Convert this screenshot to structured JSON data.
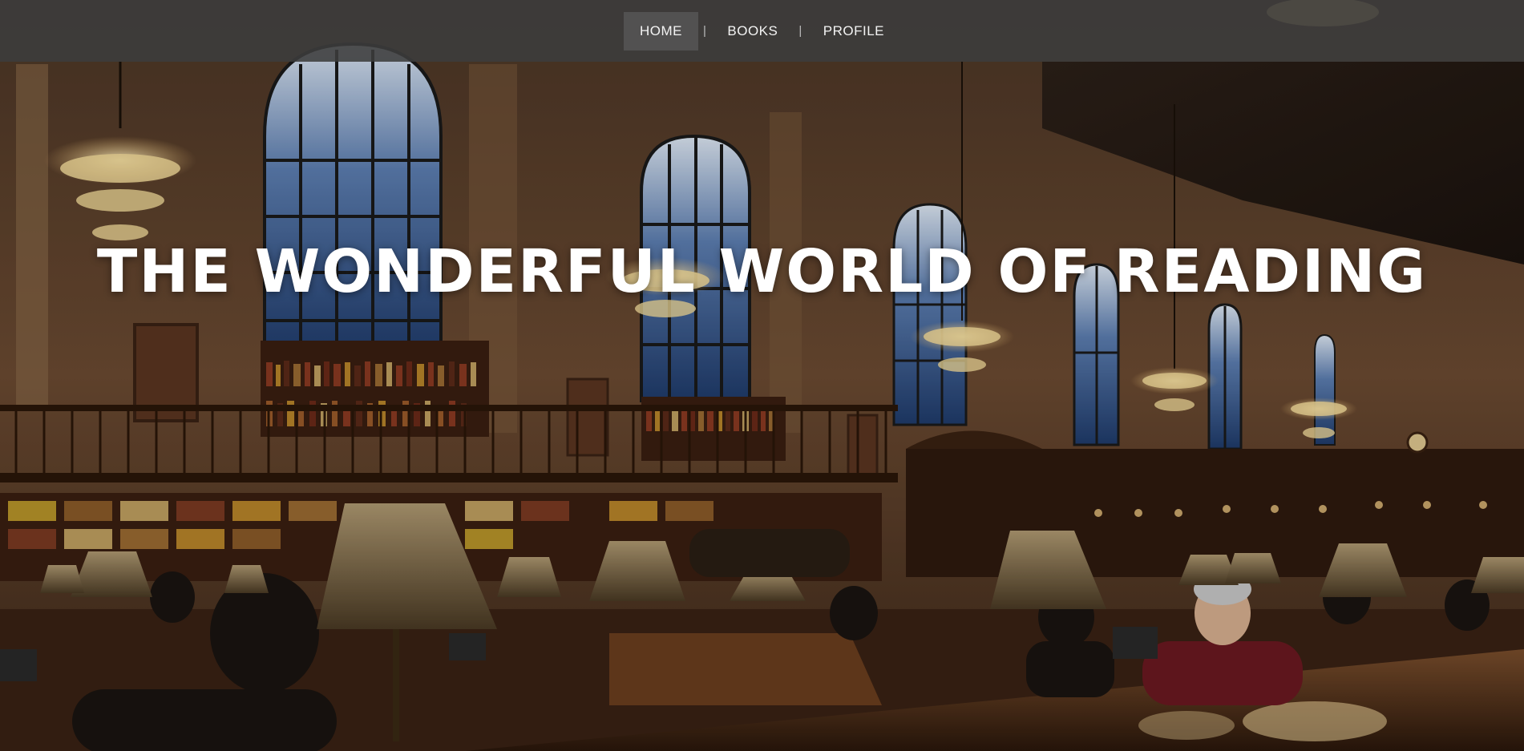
{
  "nav": {
    "items": [
      {
        "label": "HOME",
        "active": true
      },
      {
        "label": "BOOKS",
        "active": false
      },
      {
        "label": "PROFILE",
        "active": false
      }
    ],
    "separator": "|"
  },
  "hero": {
    "title": "THE WONDERFUL WORLD OF READING",
    "background": "library reading room photo"
  },
  "colors": {
    "nav_bg": "#3c3c3c",
    "nav_text": "#f3f3f3",
    "title": "#ffffff",
    "wood": "#5a3a24",
    "lamp": "#8a7350"
  }
}
